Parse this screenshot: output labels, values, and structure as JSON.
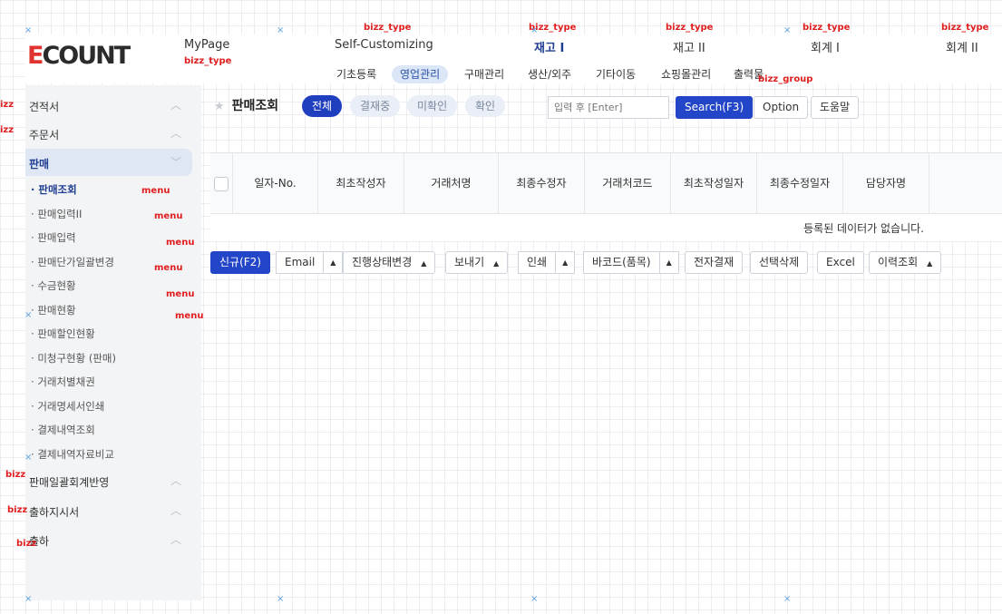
{
  "logo": {
    "text": "ECOUNT"
  },
  "top_tabs": [
    {
      "label": "MyPage"
    },
    {
      "label": "Self-Customizing"
    },
    {
      "label": "재고 I"
    },
    {
      "label": "재고 II"
    },
    {
      "label": "회계 I"
    },
    {
      "label": "회계 II"
    }
  ],
  "sub_nav": [
    "기초등록",
    "영업관리",
    "구매관리",
    "생산/외주",
    "기타이동",
    "쇼핑몰관리",
    "출력물"
  ],
  "sidebar": {
    "groups": [
      "견적서",
      "주문서",
      "판매",
      "판매일괄회계반영",
      "출하지시서",
      "출하"
    ],
    "items": [
      "판매조회",
      "판매입력II",
      "판매입력",
      "판매단가일괄변경",
      "수금현황",
      "판매현황",
      "판매할인현황",
      "미청구현황 (판매)",
      "거래처별채권",
      "거래명세서인쇄",
      "결제내역조회",
      "결제내역자료비교"
    ]
  },
  "main": {
    "title": "판매조회",
    "filters": [
      "전체",
      "결재중",
      "미확인",
      "확인"
    ],
    "search_placeholder": "입력 후 [Enter]",
    "search_button": "Search(F3)",
    "option_button": "Option",
    "help_button": "도움말"
  },
  "table": {
    "columns": [
      "일자-No.",
      "최초작성자",
      "거래처명",
      "최종수정자",
      "거래처코드",
      "최초작성일자",
      "최종수정일자",
      "담당자명"
    ],
    "empty_text": "등록된 데이터가 없습니다."
  },
  "actions": {
    "new": "신규(F2)",
    "email": "Email",
    "status": "진행상태변경",
    "export": "보내기",
    "print": "인쇄",
    "barcode": "바코드(품목)",
    "approval": "전자결재",
    "delete": "선택삭제",
    "excel": "Excel",
    "history": "이력조회"
  },
  "debug_labels": {
    "bizz_type": "bizz_type",
    "bizz_group": "bizz_group",
    "menu": "menu",
    "bizz": "bizz",
    "bizz_short": "izz"
  },
  "icons": {
    "star": "star-icon",
    "chevron": "chevron-icon",
    "caret": "caret-up-icon",
    "marker": "cross-marker-icon"
  }
}
